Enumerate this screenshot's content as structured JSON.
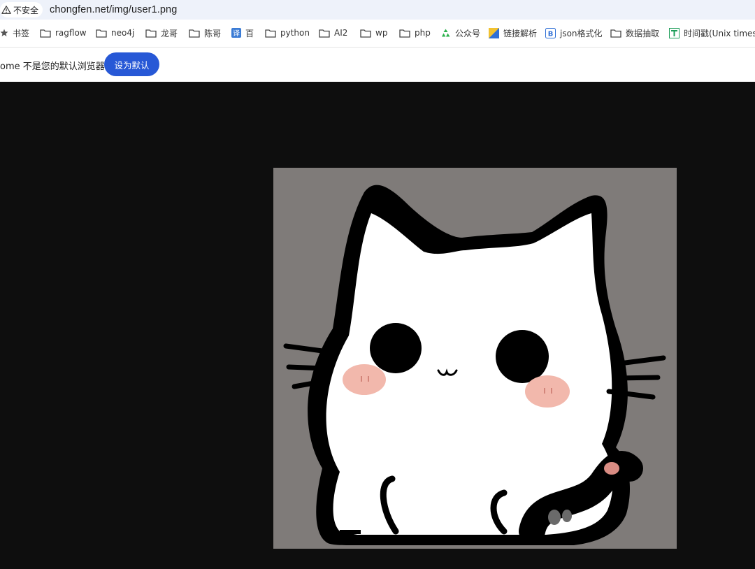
{
  "address_bar": {
    "security_label": "不安全",
    "url": "chongfen.net/img/user1.png"
  },
  "bookmarks": [
    {
      "icon": "star-icon",
      "label": "书签"
    },
    {
      "icon": "folder-icon",
      "label": "ragflow"
    },
    {
      "icon": "folder-icon",
      "label": "neo4j"
    },
    {
      "icon": "folder-icon",
      "label": "龙哥"
    },
    {
      "icon": "folder-icon",
      "label": "陈哥"
    },
    {
      "icon": "translate-icon",
      "label": "百"
    },
    {
      "icon": "folder-icon",
      "label": "python"
    },
    {
      "icon": "folder-icon",
      "label": "AI2"
    },
    {
      "icon": "folder-icon",
      "label": "wp"
    },
    {
      "icon": "folder-icon",
      "label": "php"
    },
    {
      "icon": "wechat-recycle-icon",
      "label": "公众号"
    },
    {
      "icon": "link-parse-icon",
      "label": "链接解析"
    },
    {
      "icon": "json-icon",
      "label": "json格式化"
    },
    {
      "icon": "folder-icon",
      "label": "数据抽取"
    },
    {
      "icon": "timestamp-icon",
      "label": "时间戳(Unix timest..."
    }
  ],
  "infobar": {
    "message": "ome 不是您的默认浏览器",
    "button_label": "设为默认"
  },
  "colors": {
    "page_background": "#0e0e0e",
    "image_background": "#7f7b79",
    "infobar_button": "#2758d6"
  },
  "image": {
    "subject": "cartoon white cat"
  }
}
